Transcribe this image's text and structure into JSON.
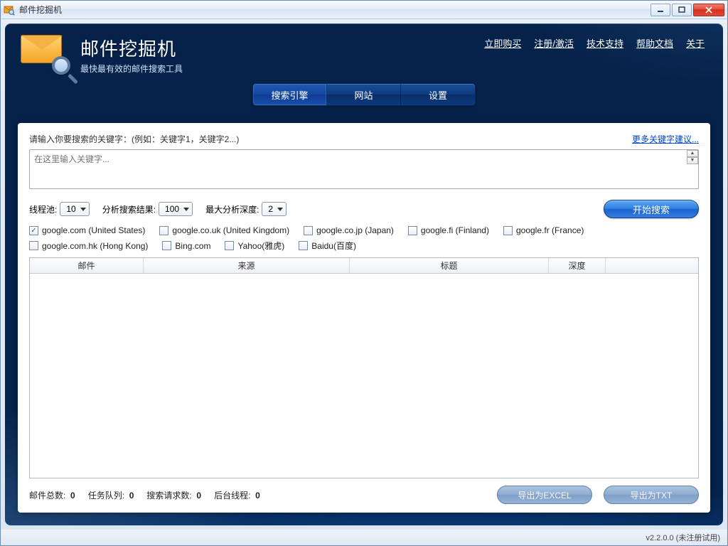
{
  "window": {
    "title": "邮件挖掘机"
  },
  "brand": {
    "title": "邮件挖掘机",
    "subtitle": "最快最有效的邮件搜索工具"
  },
  "header_links": {
    "buy": "立即购买",
    "register": "注册/激活",
    "support": "技术支持",
    "docs": "帮助文档",
    "about": "关于"
  },
  "tabs": {
    "search_engine": "搜索引擎",
    "website": "网站",
    "settings": "设置",
    "selected": "search_engine"
  },
  "prompt": "请输入你要搜索的关键字：(例如：关键字1，关键字2...)",
  "more_keywords_link": "更多关键字建议...",
  "keyword_placeholder": "在这里输入关键字...",
  "options": {
    "thread_pool_label": "线程池:",
    "thread_pool_value": "10",
    "analyze_results_label": "分析搜索结果:",
    "analyze_results_value": "100",
    "max_depth_label": "最大分析深度:",
    "max_depth_value": "2"
  },
  "start_button": "开始搜索",
  "engines": [
    {
      "label": "google.com (United States)",
      "checked": true
    },
    {
      "label": "google.co.uk (United Kingdom)",
      "checked": false
    },
    {
      "label": "google.co.jp (Japan)",
      "checked": false
    },
    {
      "label": "google.fi (Finland)",
      "checked": false
    },
    {
      "label": "google.fr (France)",
      "checked": false
    },
    {
      "label": "google.com.hk (Hong Kong)",
      "checked": false
    },
    {
      "label": "Bing.com",
      "checked": false
    },
    {
      "label": "Yahoo(雅虎)",
      "checked": false
    },
    {
      "label": "Baidu(百度)",
      "checked": false
    }
  ],
  "grid_headers": {
    "email": "邮件",
    "source": "来源",
    "title": "标题",
    "depth": "深度",
    "extra": ""
  },
  "status": {
    "total_emails_label": "邮件总数:",
    "total_emails_value": "0",
    "queue_label": "任务队列:",
    "queue_value": "0",
    "requests_label": "搜索请求数:",
    "requests_value": "0",
    "bg_threads_label": "后台线程:",
    "bg_threads_value": "0"
  },
  "export": {
    "excel": "导出为EXCEL",
    "txt": "导出为TXT"
  },
  "footer": {
    "version": "v2.2.0.0 (未注册试用)"
  }
}
